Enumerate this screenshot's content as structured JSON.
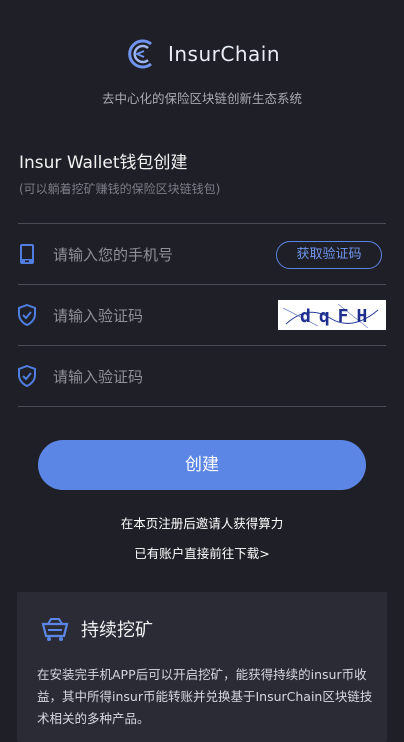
{
  "brand": {
    "logo_text": "InsurChain",
    "tagline": "去中心化的保险区块链创新生态系统"
  },
  "form": {
    "title": "Insur Wallet钱包创建",
    "subtitle": "(可以躺着挖矿赚钱的保险区块链钱包)",
    "phone_placeholder": "请输入您的手机号",
    "sms_button": "获取验证码",
    "captcha_placeholder": "请输入验证码",
    "captcha_text": "dqFH",
    "code_placeholder": "请输入验证码",
    "submit": "创建"
  },
  "links": {
    "invite": "在本页注册后邀请人获得算力",
    "download": "已有账户直接前往下载>"
  },
  "card": {
    "title": "持续挖矿",
    "body": "在安装完手机APP后可以开启挖矿，能获得持续的insur币收益，其中所得insur币能转账并兑换基于InsurChain区块链技术相关的多种产品。"
  },
  "colors": {
    "background": "#1f1f27",
    "accent": "#5b86e5",
    "card": "#2a2b35"
  },
  "icons": {
    "logo": "insurchain-logo-icon",
    "phone": "phone-icon",
    "shield": "shield-check-icon",
    "mining": "mining-cart-icon"
  }
}
